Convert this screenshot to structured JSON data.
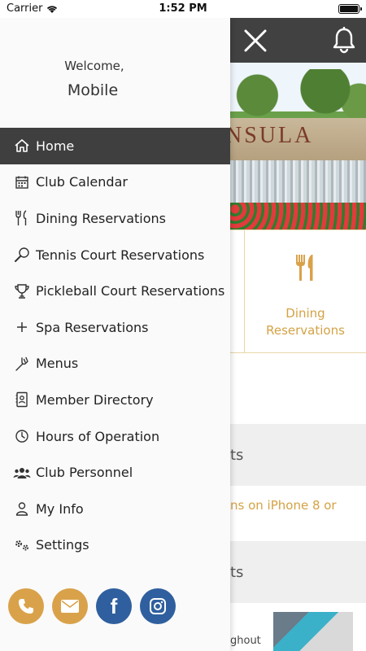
{
  "status_bar": {
    "carrier": "Carrier",
    "time": "1:52 PM"
  },
  "drawer": {
    "welcome": "Welcome,",
    "user_name": "Mobile",
    "menu": [
      {
        "label": "Home",
        "icon": "home-icon",
        "active": true
      },
      {
        "label": "Club Calendar",
        "icon": "calendar-icon"
      },
      {
        "label": "Dining Reservations",
        "icon": "fork-knife-icon"
      },
      {
        "label": "Tennis Court Reservations",
        "icon": "tennis-racket-icon"
      },
      {
        "label": "Pickleball Court Reservations",
        "icon": "trophy-icon"
      },
      {
        "label": "Spa Reservations",
        "icon": "plus-icon"
      },
      {
        "label": "Menus",
        "icon": "fork-icon"
      },
      {
        "label": "Member Directory",
        "icon": "contact-book-icon"
      },
      {
        "label": "Hours of Operation",
        "icon": "clock-icon"
      },
      {
        "label": "Club Personnel",
        "icon": "people-icon"
      },
      {
        "label": "My Info",
        "icon": "person-icon"
      },
      {
        "label": "Settings",
        "icon": "gears-icon"
      }
    ],
    "social": [
      "phone-icon",
      "mail-icon",
      "facebook-icon",
      "instagram-icon"
    ]
  },
  "main": {
    "hero_sign_text": "NSULA",
    "tile_label": "Dining\nReservations",
    "section1_title": "ts",
    "news_text": "ns on iPhone 8 or",
    "section2_title": "ts",
    "news2_text": "ghout"
  },
  "colors": {
    "accent": "#d9a24a",
    "topbar": "#414141",
    "active": "#3f3f3f",
    "facebook": "#2f5f9e"
  }
}
